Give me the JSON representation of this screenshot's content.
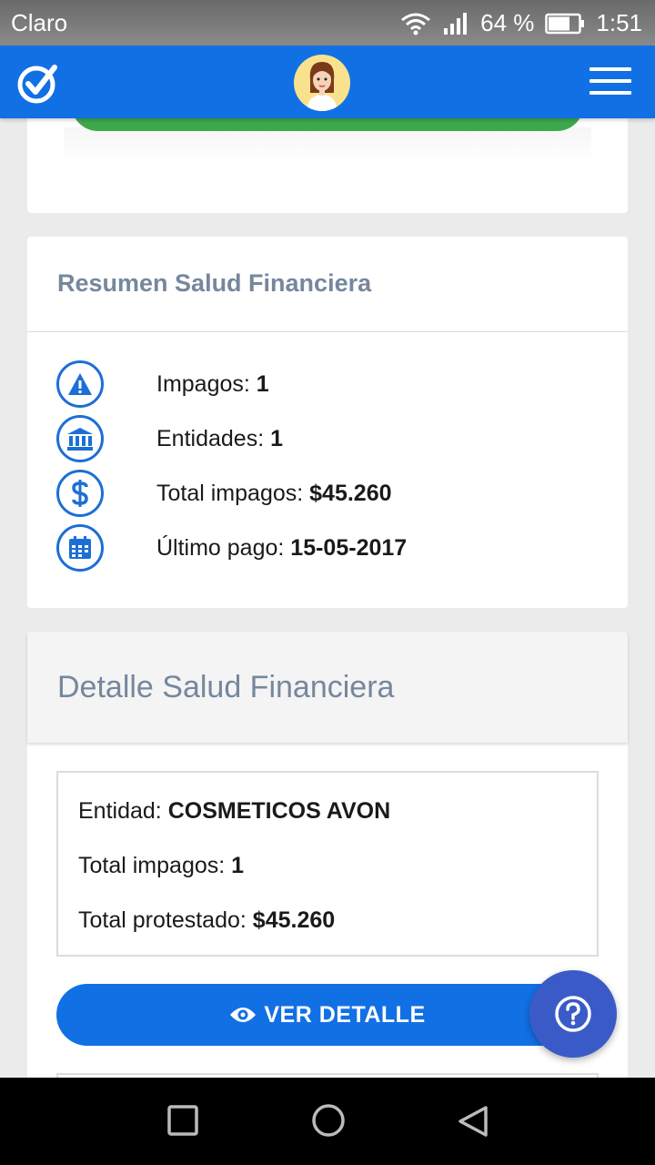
{
  "status_bar": {
    "carrier": "Claro",
    "battery_percent": "64 %",
    "time": "1:51"
  },
  "header": {
    "logo_icon": "check-circle-icon",
    "avatar_icon": "user-avatar",
    "menu_icon": "hamburger-menu-icon"
  },
  "resumen": {
    "title": "Resumen Salud Financiera",
    "items": [
      {
        "icon": "warning-icon",
        "label": "Impagos: ",
        "value": "1"
      },
      {
        "icon": "bank-icon",
        "label": "Entidades: ",
        "value": "1"
      },
      {
        "icon": "dollar-icon",
        "label": "Total impagos: ",
        "value": "$45.260"
      },
      {
        "icon": "calendar-icon",
        "label": "Último pago: ",
        "value": "15-05-2017"
      }
    ]
  },
  "detalle": {
    "title": "Detalle Salud Financiera",
    "entidad_label": "Entidad: ",
    "entidad_value": "COSMETICOS AVON",
    "total_impagos_label": "Total impagos: ",
    "total_impagos_value": "1",
    "total_protestado_label": "Total protestado: ",
    "total_protestado_value": "$45.260",
    "button_label": "VER DETALLE"
  },
  "colors": {
    "primary": "#1270e5",
    "green": "#3ea84c",
    "fab": "#3a5bc7",
    "title_gray": "#76879d"
  }
}
